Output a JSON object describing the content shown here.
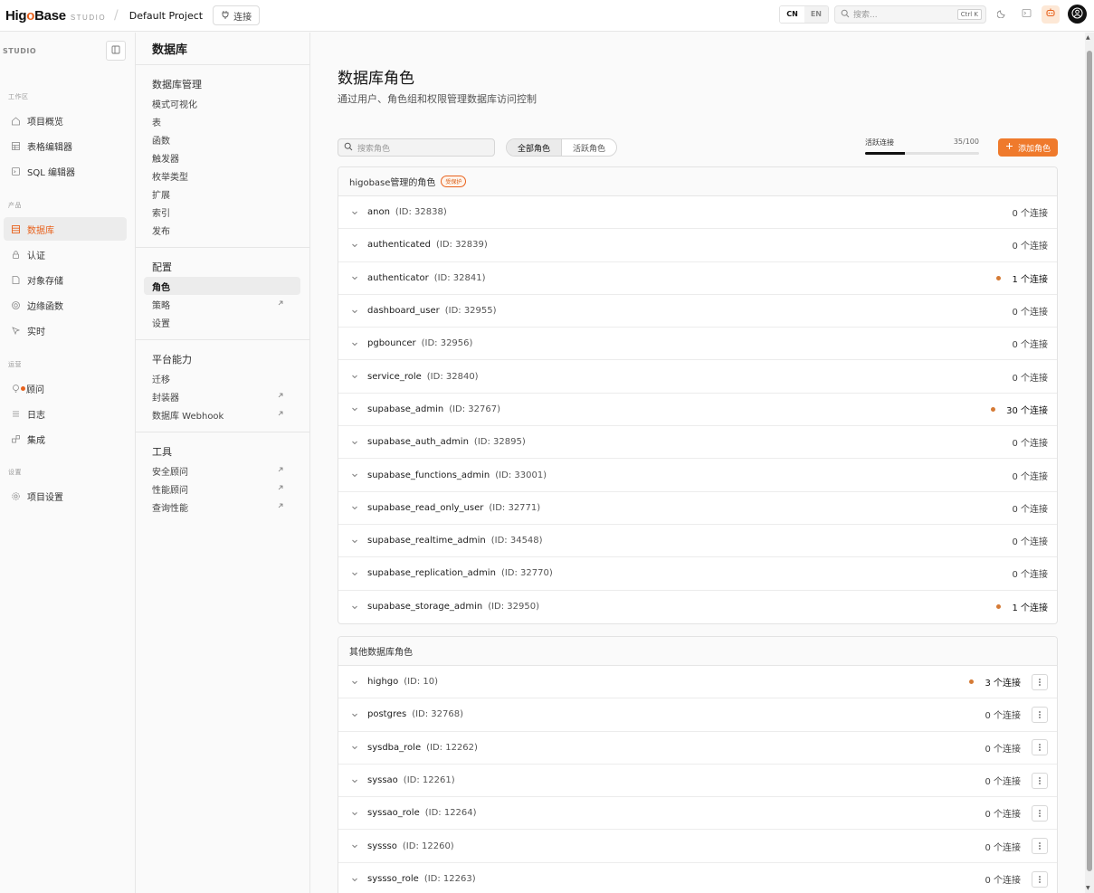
{
  "app": {
    "logo_prefix": "Hig",
    "logo_o": "o",
    "logo_suffix": "Base",
    "logo_sub": "STUDIO",
    "project": "Default Project",
    "connect_label": "连接",
    "lang_cn": "CN",
    "lang_en": "EN",
    "search_placeholder": "搜索...",
    "search_shortcut": "Ctrl K"
  },
  "sidebar": {
    "studio_label": "STUDIO",
    "sections": [
      {
        "title": "工作区",
        "items": [
          {
            "label": "项目概览",
            "icon": "home-icon"
          },
          {
            "label": "表格编辑器",
            "icon": "table-icon"
          },
          {
            "label": "SQL 编辑器",
            "icon": "sql-icon"
          }
        ]
      },
      {
        "title": "产品",
        "items": [
          {
            "label": "数据库",
            "icon": "database-icon",
            "active": true
          },
          {
            "label": "认证",
            "icon": "lock-icon"
          },
          {
            "label": "对象存储",
            "icon": "storage-icon"
          },
          {
            "label": "边缘函数",
            "icon": "function-icon"
          },
          {
            "label": "实时",
            "icon": "realtime-icon"
          }
        ]
      },
      {
        "title": "运营",
        "items": [
          {
            "label": "顾问",
            "icon": "bulb-icon",
            "dot": true
          },
          {
            "label": "日志",
            "icon": "list-icon"
          },
          {
            "label": "集成",
            "icon": "integration-icon"
          }
        ]
      },
      {
        "title": "设置",
        "items": [
          {
            "label": "项目设置",
            "icon": "gear-icon"
          }
        ]
      }
    ]
  },
  "subnav": {
    "title": "数据库",
    "groups": [
      {
        "title": "数据库管理",
        "items": [
          {
            "label": "模式可视化"
          },
          {
            "label": "表"
          },
          {
            "label": "函数"
          },
          {
            "label": "触发器"
          },
          {
            "label": "枚举类型"
          },
          {
            "label": "扩展"
          },
          {
            "label": "索引"
          },
          {
            "label": "发布"
          }
        ]
      },
      {
        "title": "配置",
        "items": [
          {
            "label": "角色",
            "active": true
          },
          {
            "label": "策略",
            "ext": true
          },
          {
            "label": "设置"
          }
        ]
      },
      {
        "title": "平台能力",
        "items": [
          {
            "label": "迁移"
          },
          {
            "label": "封装器",
            "ext": true
          },
          {
            "label": "数据库 Webhook",
            "ext": true
          }
        ]
      },
      {
        "title": "工具",
        "items": [
          {
            "label": "安全顾问",
            "ext": true
          },
          {
            "label": "性能顾问",
            "ext": true
          },
          {
            "label": "查询性能",
            "ext": true
          }
        ]
      }
    ]
  },
  "main": {
    "title": "数据库角色",
    "subtitle": "通过用户、角色组和权限管理数据库访问控制",
    "search_placeholder": "搜索角色",
    "filter_all": "全部角色",
    "filter_active": "活跃角色",
    "active_conn_label": "活跃连接",
    "active_conn_count": "35/100",
    "active_conn_fraction": 0.35,
    "add_role_label": "添加角色",
    "protected_group": {
      "title": "higobase管理的角色",
      "badge": "受保护",
      "roles": [
        {
          "name": "anon",
          "id": "(ID: 32838)",
          "conn": "0 个连接",
          "active": false
        },
        {
          "name": "authenticated",
          "id": "(ID: 32839)",
          "conn": "0 个连接",
          "active": false
        },
        {
          "name": "authenticator",
          "id": "(ID: 32841)",
          "conn": "1 个连接",
          "active": true
        },
        {
          "name": "dashboard_user",
          "id": "(ID: 32955)",
          "conn": "0 个连接",
          "active": false
        },
        {
          "name": "pgbouncer",
          "id": "(ID: 32956)",
          "conn": "0 个连接",
          "active": false
        },
        {
          "name": "service_role",
          "id": "(ID: 32840)",
          "conn": "0 个连接",
          "active": false
        },
        {
          "name": "supabase_admin",
          "id": "(ID: 32767)",
          "conn": "30 个连接",
          "active": true
        },
        {
          "name": "supabase_auth_admin",
          "id": "(ID: 32895)",
          "conn": "0 个连接",
          "active": false
        },
        {
          "name": "supabase_functions_admin",
          "id": "(ID: 33001)",
          "conn": "0 个连接",
          "active": false
        },
        {
          "name": "supabase_read_only_user",
          "id": "(ID: 32771)",
          "conn": "0 个连接",
          "active": false
        },
        {
          "name": "supabase_realtime_admin",
          "id": "(ID: 34548)",
          "conn": "0 个连接",
          "active": false
        },
        {
          "name": "supabase_replication_admin",
          "id": "(ID: 32770)",
          "conn": "0 个连接",
          "active": false
        },
        {
          "name": "supabase_storage_admin",
          "id": "(ID: 32950)",
          "conn": "1 个连接",
          "active": true
        }
      ]
    },
    "other_group": {
      "title": "其他数据库角色",
      "roles": [
        {
          "name": "highgo",
          "id": "(ID: 10)",
          "conn": "3 个连接",
          "active": true
        },
        {
          "name": "postgres",
          "id": "(ID: 32768)",
          "conn": "0 个连接",
          "active": false
        },
        {
          "name": "sysdba_role",
          "id": "(ID: 12262)",
          "conn": "0 个连接",
          "active": false
        },
        {
          "name": "syssao",
          "id": "(ID: 12261)",
          "conn": "0 个连接",
          "active": false
        },
        {
          "name": "syssao_role",
          "id": "(ID: 12264)",
          "conn": "0 个连接",
          "active": false
        },
        {
          "name": "syssso",
          "id": "(ID: 12260)",
          "conn": "0 个连接",
          "active": false
        },
        {
          "name": "syssso_role",
          "id": "(ID: 12263)",
          "conn": "0 个连接",
          "active": false
        }
      ]
    }
  }
}
